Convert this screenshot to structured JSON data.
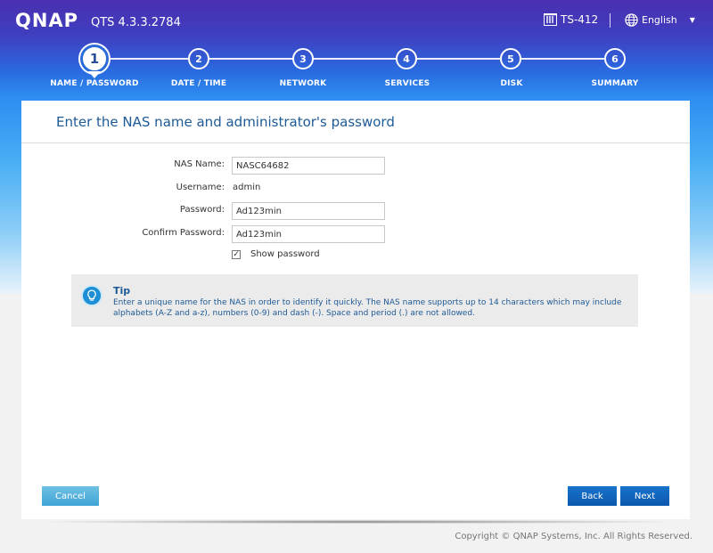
{
  "header": {
    "logo": "QNAP",
    "version": "QTS 4.3.3.2784",
    "model": "TS-412",
    "language": "English"
  },
  "steps": [
    {
      "number": "1",
      "label": "NAME / PASSWORD"
    },
    {
      "number": "2",
      "label": "DATE / TIME"
    },
    {
      "number": "3",
      "label": "NETWORK"
    },
    {
      "number": "4",
      "label": "SERVICES"
    },
    {
      "number": "5",
      "label": "DISK"
    },
    {
      "number": "6",
      "label": "SUMMARY"
    }
  ],
  "main": {
    "title": "Enter the NAS name and administrator's password",
    "fields": {
      "nas_name_label": "NAS Name:",
      "nas_name_value": "NASC64682",
      "username_label": "Username:",
      "username_value": "admin",
      "password_label": "Password:",
      "password_value": "Ad123min",
      "confirm_label": "Confirm Password:",
      "confirm_value": "Ad123min"
    },
    "show_password_label": "Show password",
    "show_password_checked": true,
    "tip": {
      "title": "Tip",
      "text": "Enter a unique name for the NAS in order to identify it quickly. The NAS name supports up to 14 characters which may include alphabets (A-Z and a-z), numbers (0-9) and dash (-). Space and period (.) are not allowed."
    }
  },
  "buttons": {
    "cancel": "Cancel",
    "back": "Back",
    "next": "Next"
  },
  "footer": {
    "copyright": "Copyright © QNAP Systems, Inc. All Rights Reserved."
  },
  "colors": {
    "header_top": "#4a2fb0",
    "accent_blue": "#1e5a96",
    "button_primary": "#0c58ad",
    "button_cancel": "#3fa3d4"
  },
  "current_step": 1
}
